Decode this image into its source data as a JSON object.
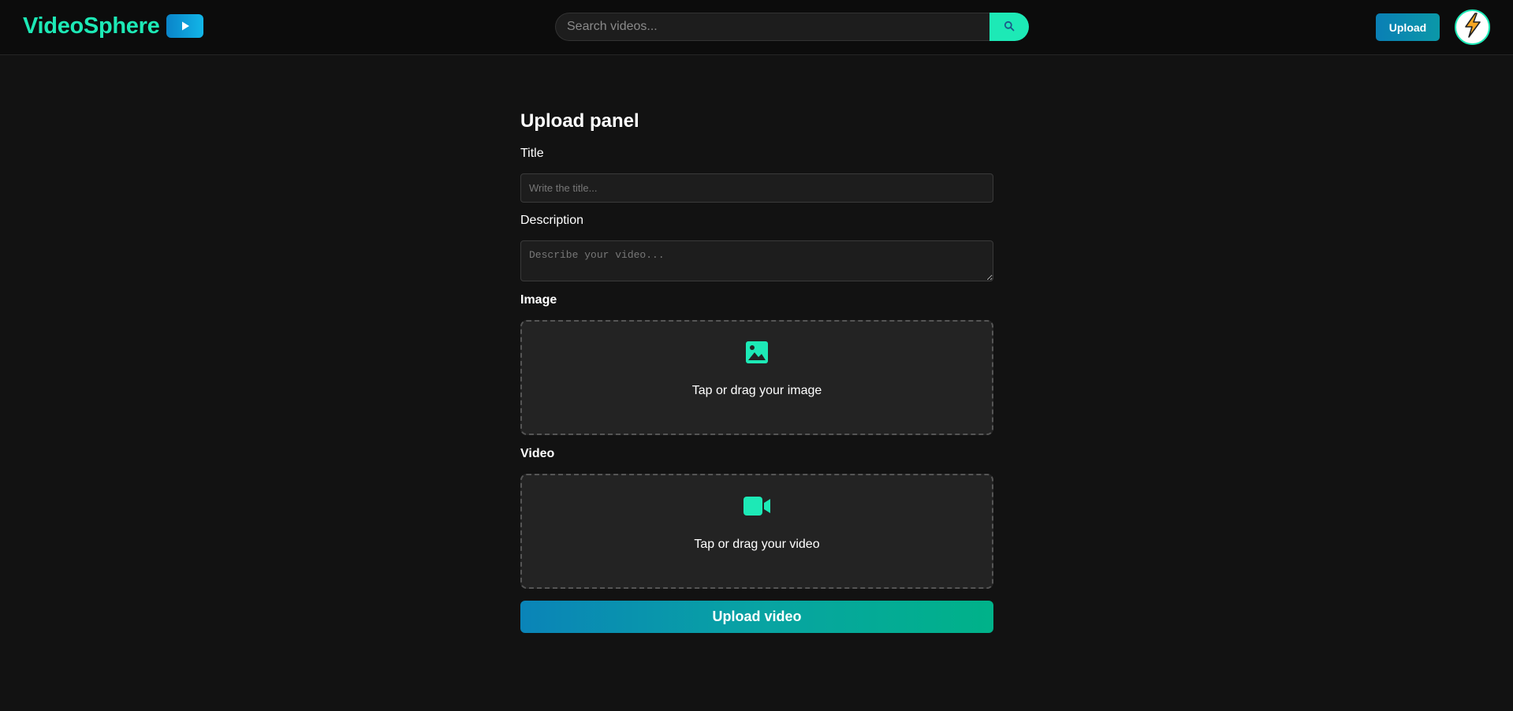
{
  "header": {
    "brand_name": "VideoSphere",
    "search_placeholder": "Search videos...",
    "upload_label": "Upload"
  },
  "panel": {
    "title": "Upload panel",
    "title_field": {
      "label": "Title",
      "placeholder": "Write the title...",
      "value": ""
    },
    "description_field": {
      "label": "Description",
      "placeholder": "Describe your video...",
      "value": ""
    },
    "image_field": {
      "label": "Image",
      "dropzone_text": "Tap or drag your image",
      "icon": "image-icon"
    },
    "video_field": {
      "label": "Video",
      "dropzone_text": "Tap or drag your video",
      "icon": "video-camera-icon"
    },
    "submit_label": "Upload video"
  },
  "colors": {
    "accent": "#1de9b6",
    "background": "#121212",
    "header_background": "#0c0c0c",
    "input_background": "#1d1d1d",
    "dropzone_background": "#232323",
    "button_gradient_start": "#0a84b8",
    "button_gradient_end": "#00b289",
    "avatar_bolt": "#f5a623"
  }
}
